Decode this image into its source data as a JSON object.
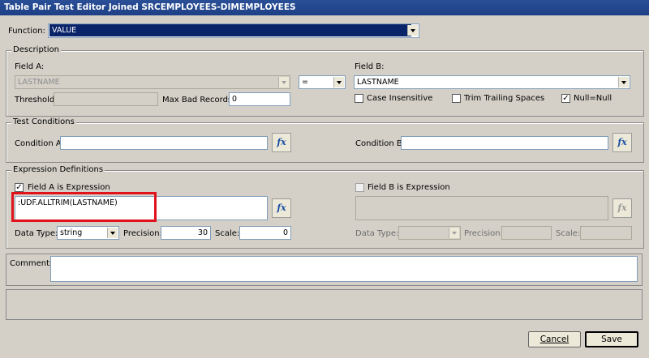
{
  "window": {
    "title": "Table Pair Test Editor Joined SRCEMPLOYEES-DIMEMPLOYEES"
  },
  "function": {
    "label": "Function:",
    "value": "VALUE"
  },
  "description": {
    "group_title": "Description",
    "field_a_label": "Field A:",
    "field_a_value": "LASTNAME",
    "operator_value": "=",
    "field_b_label": "Field B:",
    "field_b_value": "LASTNAME",
    "threshold_label": "Threshold:",
    "threshold_value": "",
    "max_bad_label": "Max Bad Records:",
    "max_bad_value": "0",
    "case_insensitive_label": "Case Insensitive",
    "case_insensitive_checked": false,
    "trim_label": "Trim Trailing Spaces",
    "trim_checked": false,
    "null_label": "Null=Null",
    "null_checked": true
  },
  "test_conditions": {
    "group_title": "Test Conditions",
    "condition_a_label": "Condition A:",
    "condition_a_value": "",
    "condition_b_label": "Condition B:",
    "condition_b_value": ""
  },
  "expression": {
    "group_title": "Expression Definitions",
    "field_a_expr_label": "Field A is Expression",
    "field_a_expr_checked": true,
    "field_a_expr_value": ":UDF.ALLTRIM(LASTNAME)",
    "field_b_expr_label": "Field B is Expression",
    "field_b_expr_checked": false,
    "field_b_expr_value": "",
    "data_type_label": "Data Type:",
    "data_type_a_value": "string",
    "precision_label": "Precision:",
    "precision_a_value": "30",
    "scale_label": "Scale:",
    "scale_a_value": "0",
    "data_type_b_value": "",
    "precision_b_value": "",
    "scale_b_value": "",
    "fx_symbol": "fx"
  },
  "comments": {
    "label": "Comments:",
    "value": ""
  },
  "buttons": {
    "cancel": "Cancel",
    "save": "Save"
  },
  "colors": {
    "title_bar": "#1d3f86",
    "highlight": "#e0121b",
    "selection": "#0a246a"
  },
  "icons": {
    "function_button": "fx-function-icon",
    "dropdown": "chevron-down-icon",
    "check": "checkmark-icon"
  }
}
